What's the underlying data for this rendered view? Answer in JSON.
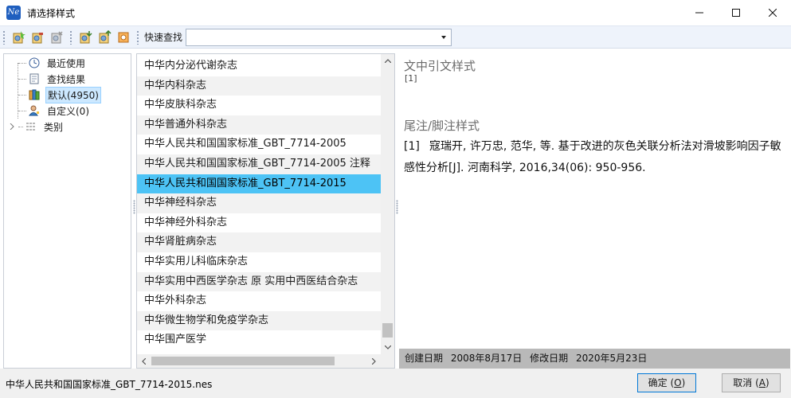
{
  "window": {
    "title": "请选择样式",
    "icon_text": "Ne"
  },
  "toolbar": {
    "quick_search_label": "快速查找",
    "quick_search_value": ""
  },
  "tree": {
    "items": [
      {
        "label": "最近使用",
        "icon": "clock-icon"
      },
      {
        "label": "查找结果",
        "icon": "document-icon"
      },
      {
        "label": "默认(4950)",
        "icon": "library-icon",
        "selected": true
      },
      {
        "label": "自定义(0)",
        "icon": "user-icon"
      },
      {
        "label": "类别",
        "icon": "grid-icon",
        "collapsed": true
      }
    ]
  },
  "style_list": {
    "items": [
      "中华内分泌代谢杂志",
      "中华内科杂志",
      "中华皮肤科杂志",
      "中华普通外科杂志",
      "中华人民共和国国家标准_GBT_7714-2005",
      "中华人民共和国国家标准_GBT_7714-2005 注释",
      "中华人民共和国国家标准_GBT_7714-2015",
      "中华神经科杂志",
      "中华神经外科杂志",
      "中华肾脏病杂志",
      "中华实用儿科临床杂志",
      "中华实用中西医学杂志 原 实用中西医结合杂志",
      "中华外科杂志",
      "中华微生物学和免疫学杂志",
      "中华围产医学"
    ],
    "selected_index": 6
  },
  "preview": {
    "in_text_title": "文中引文样式",
    "in_text_marker": "[1]",
    "footnote_title": "尾注/脚注样式",
    "ref_number": "[1]",
    "ref_text": "寇瑞开, 许万忠, 范华, 等. 基于改进的灰色关联分析法对滑坡影响因子敏感性分析[J]. 河南科学, 2016,34(06): 950-956.",
    "created_label": "创建日期",
    "created_value": "2008年8月17日",
    "modified_label": "修改日期",
    "modified_value": "2020年5月23日"
  },
  "footer": {
    "filename": "中华人民共和国国家标准_GBT_7714-2015.nes",
    "ok_label": "确定 (",
    "ok_key": "O",
    "cancel_label": "取消 (",
    "cancel_key": "A",
    "close_paren": ")"
  },
  "colors": {
    "selection": "#4dc3f5",
    "toolbar_bg": "#eef3fb",
    "status_bg": "#b9b9b9"
  }
}
